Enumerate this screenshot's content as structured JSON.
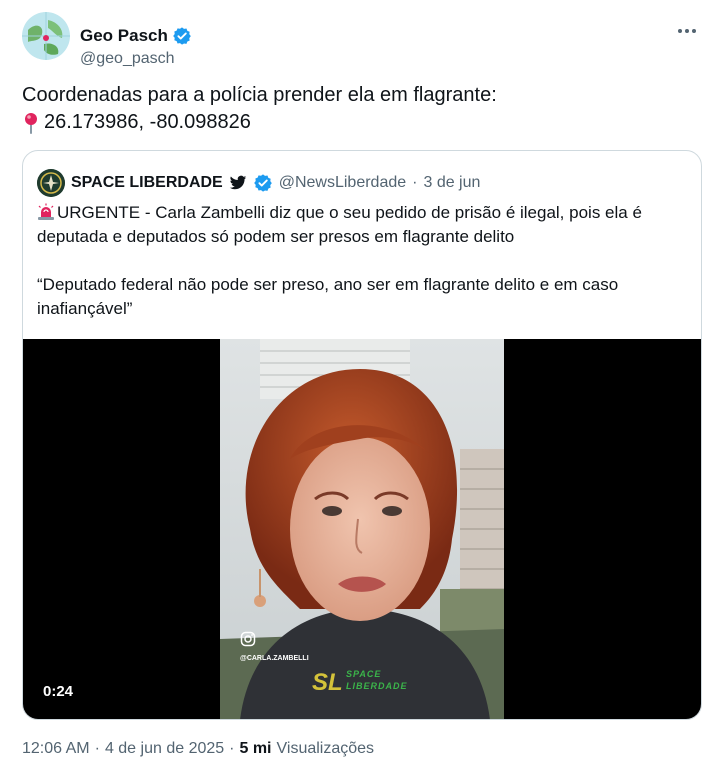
{
  "author": {
    "display_name": "Geo Pasch",
    "handle": "@geo_pasch",
    "verified_icon": "verified-badge-icon"
  },
  "more_icon": "more-dots-icon",
  "tweet": {
    "line1": "Coordenadas para a polícia prender ela em flagrante:",
    "line2": "26.173986, -80.098826",
    "pin_icon": "round-pushpin-icon"
  },
  "quoted": {
    "display_name": "SPACE LIBERDADE",
    "handle": "@NewsLiberdade",
    "separator": "·",
    "date": "3 de jun",
    "siren_icon": "police-light-icon",
    "paragraph1": "URGENTE - Carla Zambelli diz que o seu pedido de prisão é ilegal, pois ela é deputada e deputados só podem ser presos em flagrante delito",
    "paragraph2": "“Deputado federal não pode ser preso,  ano ser em flagrante delito e em caso inafiançável”",
    "video": {
      "duration": "0:24",
      "overlay_handle": "@CARLA.ZAMBELLI",
      "watermark_line1": "SPACE",
      "watermark_line2": "LIBERDADE",
      "watermark_short": "SL"
    }
  },
  "footer": {
    "time": "12:06 AM",
    "separator1": "·",
    "date": "4 de jun de 2025",
    "separator2": "·",
    "views_count": "5 mi",
    "views_label": "Visualizações"
  }
}
